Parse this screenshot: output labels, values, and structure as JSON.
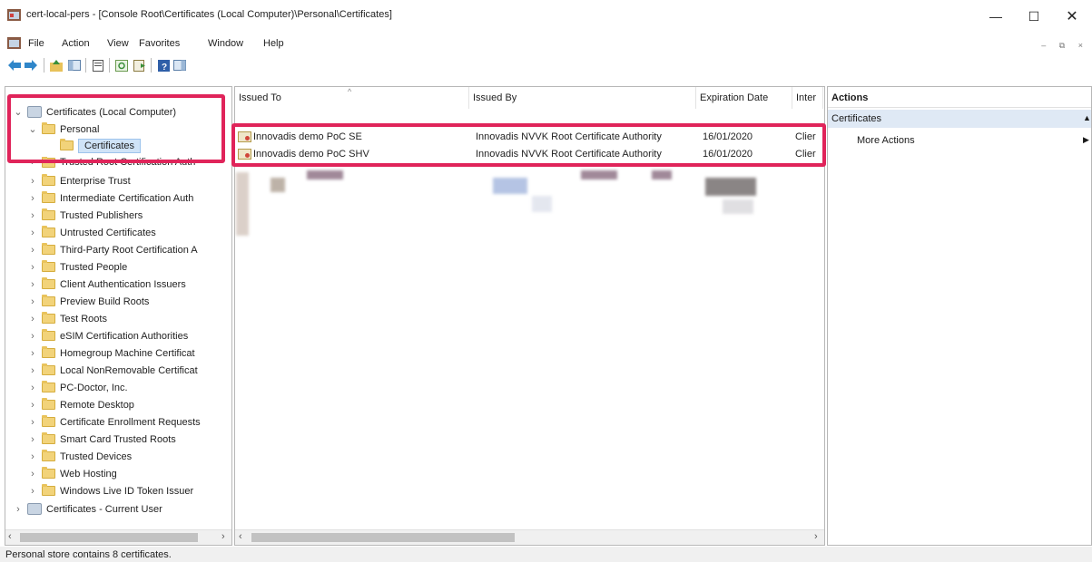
{
  "window": {
    "title": "cert-local-pers - [Console Root\\Certificates (Local Computer)\\Personal\\Certificates]",
    "minimize": "—",
    "maximize": "☐",
    "close": "✕"
  },
  "menu": {
    "items": [
      "File",
      "Action",
      "View",
      "Favorites",
      "Window",
      "Help"
    ],
    "mdi_controls": "– ⧉ ×"
  },
  "toolbar": {
    "buttons": [
      "back-icon",
      "forward-icon",
      "up-folder-icon",
      "show-tree-icon",
      "properties-icon",
      "refresh-icon",
      "export-icon",
      "help-icon",
      "show-pane-icon"
    ]
  },
  "tree": {
    "root": "Certificates (Local Computer)",
    "personal": "Personal",
    "certificates": "Certificates",
    "partial_hidden": "Trusted Root Certification Auth",
    "items": [
      "Enterprise Trust",
      "Intermediate Certification Auth",
      "Trusted Publishers",
      "Untrusted Certificates",
      "Third-Party Root Certification A",
      "Trusted People",
      "Client Authentication Issuers",
      "Preview Build Roots",
      "Test Roots",
      "eSIM Certification Authorities",
      "Homegroup Machine Certificat",
      "Local NonRemovable Certificat",
      "PC-Doctor, Inc.",
      "Remote Desktop",
      "Certificate Enrollment Requests",
      "Smart Card Trusted Roots",
      "Trusted Devices",
      "Web Hosting",
      "Windows Live ID Token Issuer"
    ],
    "current_user": "Certificates - Current User"
  },
  "list": {
    "columns": [
      "Issued To",
      "Issued By",
      "Expiration Date",
      "Inter"
    ],
    "rows": [
      {
        "issued_to": "Innovadis demo PoC SE",
        "issued_by": "Innovadis NVVK Root Certificate Authority",
        "expiration": "16/01/2020",
        "intended": "Clier"
      },
      {
        "issued_to": "Innovadis demo PoC SHV",
        "issued_by": "Innovadis NVVK Root Certificate Authority",
        "expiration": "16/01/2020",
        "intended": "Clier"
      }
    ]
  },
  "actions": {
    "header": "Actions",
    "section": "Certificates",
    "more_actions": "More Actions"
  },
  "status": {
    "text": "Personal store contains 8 certificates."
  },
  "colors": {
    "highlight": "#e0245a",
    "selection": "#cfe3f7",
    "section_bg": "#dfe9f5"
  }
}
